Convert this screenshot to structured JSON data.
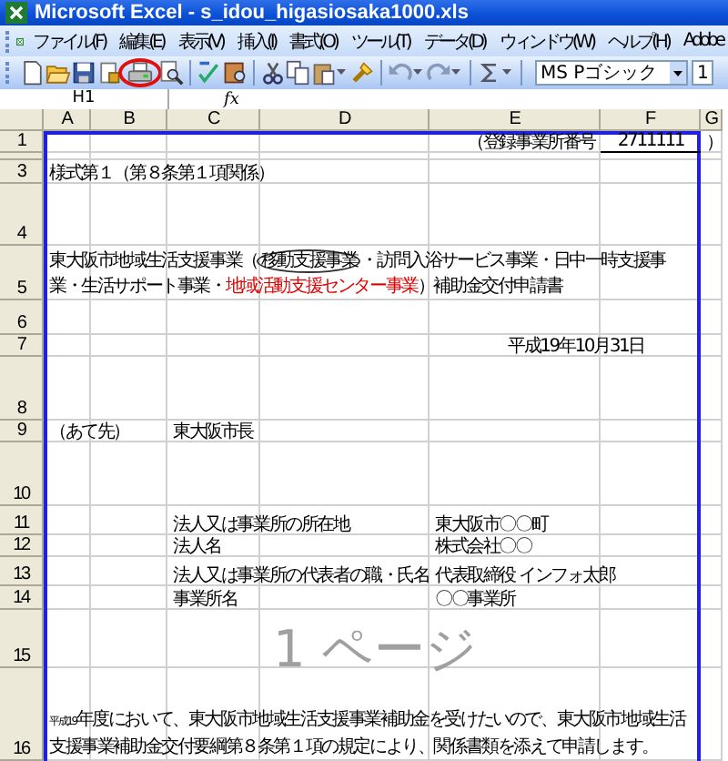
{
  "window": {
    "title": "Microsoft Excel - s_idou_higasiosaka1000.xls"
  },
  "menu": [
    "ファイル(F)",
    "編集(E)",
    "表示(V)",
    "挿入(I)",
    "書式(O)",
    "ツール(T)",
    "データ(D)",
    "ウィンドウ(W)",
    "ヘルプ(H)",
    "Adobe"
  ],
  "toolbar": {
    "button_groups": [
      [
        {
          "kind": "new",
          "circled": false,
          "menu": false
        },
        {
          "kind": "open",
          "circled": false,
          "menu": false
        },
        {
          "kind": "save",
          "circled": false,
          "menu": false
        },
        {
          "kind": "permission",
          "circled": false,
          "menu": false
        },
        {
          "kind": "print",
          "circled": true,
          "menu": false
        },
        {
          "kind": "preview",
          "circled": false,
          "menu": false
        }
      ],
      [
        {
          "kind": "spelling",
          "circled": false,
          "menu": false
        },
        {
          "kind": "research",
          "circled": false,
          "menu": false
        }
      ],
      [
        {
          "kind": "cut",
          "circled": false,
          "menu": false
        },
        {
          "kind": "copy",
          "circled": false,
          "menu": false
        },
        {
          "kind": "paste",
          "circled": false,
          "menu": true
        },
        {
          "kind": "painter",
          "circled": false,
          "menu": false
        }
      ],
      [
        {
          "kind": "undo",
          "circled": false,
          "menu": true
        },
        {
          "kind": "redo",
          "circled": false,
          "menu": true
        }
      ],
      [
        {
          "kind": "sum",
          "circled": false,
          "menu": true
        }
      ]
    ],
    "font": "MS Pゴシック",
    "size": "1"
  },
  "formula_bar": {
    "name_box": "H1",
    "function_label": "fx"
  },
  "sheet": {
    "columns": [
      "A",
      "B",
      "C",
      "D",
      "E",
      "F",
      "G"
    ],
    "rows": [
      {
        "number": "1",
        "kind": "cells",
        "cells": {
          "E": {
            "text": "（登録事業所番号",
            "underlined": false
          },
          "F": {
            "text": "2711111",
            "underlined": true
          },
          "G": {
            "text": "）",
            "underlined": false
          }
        }
      },
      {
        "kind": "cells",
        "cells": {}
      },
      {
        "number": "3",
        "kind": "cells",
        "cells": {
          "A": {
            "text": "様式第１（第８条第１項関係）",
            "underlined": false
          }
        }
      },
      {
        "number": "4",
        "kind": "cells",
        "cells": {}
      },
      {
        "number": "5",
        "kind": "merged",
        "segments": [
          {
            "kind": "plain",
            "text": "東大阪市地域生活支援事業（"
          },
          {
            "kind": "circled",
            "text": "移動支援事業"
          },
          {
            "kind": "plain",
            "text": "・訪問入浴サービス事業・日中一時支援事業・生活サポート事業・"
          },
          {
            "kind": "red",
            "text": "地域活動支援センター事業"
          },
          {
            "kind": "plain",
            "text": "）補助金交付申請書"
          }
        ]
      },
      {
        "number": "6",
        "kind": "cells",
        "cells": {}
      },
      {
        "number": "7",
        "kind": "cells",
        "cells": {
          "E": {
            "text": "平成19年10月31日",
            "underlined": false
          }
        }
      },
      {
        "number": "8",
        "kind": "cells",
        "cells": {}
      },
      {
        "number": "9",
        "kind": "cells",
        "cells": {
          "A": {
            "text": "（あて先）",
            "underlined": false
          },
          "C": {
            "text": "東大阪市長",
            "underlined": false
          }
        }
      },
      {
        "number": "10",
        "kind": "cells",
        "cells": {}
      },
      {
        "number": "11",
        "kind": "cells",
        "cells": {
          "C": {
            "text": "法人又は事業所の所在地",
            "underlined": false
          },
          "E": {
            "text": "東大阪市〇〇町",
            "underlined": false
          }
        }
      },
      {
        "number": "12",
        "kind": "cells",
        "cells": {
          "C": {
            "text": "法人名",
            "underlined": false
          },
          "E": {
            "text": "株式会社〇〇",
            "underlined": false
          }
        }
      },
      {
        "number": "13",
        "kind": "cells",
        "cells": {
          "C": {
            "text": "法人又は事業所の代表者の職・氏名",
            "underlined": false
          },
          "E": {
            "text": "代表取締役 インフォ太郎",
            "underlined": false
          }
        }
      },
      {
        "number": "14",
        "kind": "cells",
        "cells": {
          "C": {
            "text": "事業所名",
            "underlined": false
          },
          "E": {
            "text": "〇〇事業所",
            "underlined": false
          }
        }
      },
      {
        "number": "15",
        "kind": "cells",
        "cells": {}
      },
      {
        "number": "16",
        "kind": "merged",
        "segments": [
          {
            "kind": "small",
            "text": "平成19"
          },
          {
            "kind": "plain",
            "text": "年度において、東大阪市地域生活支援事業補助金を受けたいので、東大阪市地域生活支援事業補助金交付要綱第８条第１項の規定により、関係書類を添えて申請します。"
          }
        ]
      }
    ],
    "page_label": "1 ページ"
  }
}
